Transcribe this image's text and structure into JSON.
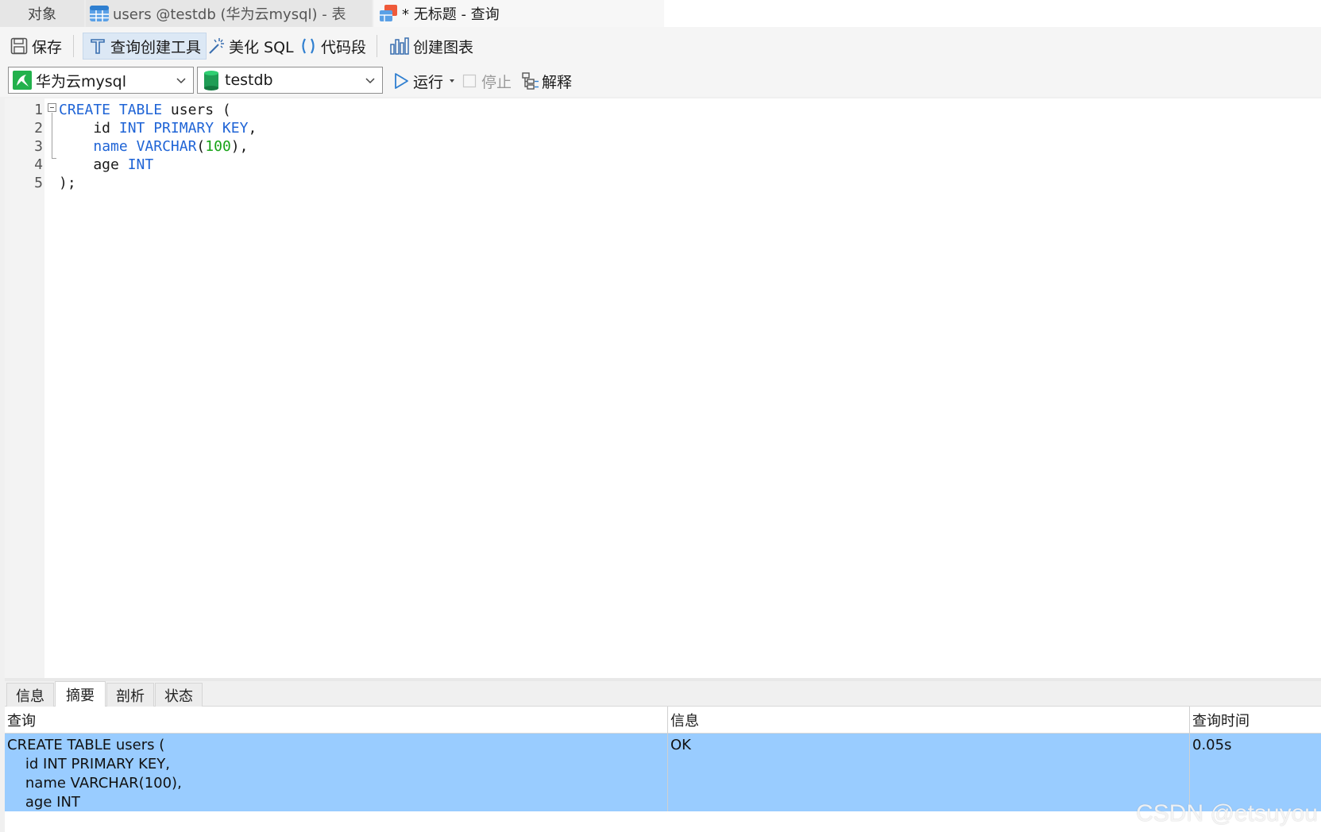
{
  "tabs": {
    "objects": "对象",
    "users_table": "users @testdb (华为云mysql) - 表",
    "query": "* 无标题 - 查询"
  },
  "toolbar": {
    "save": "保存",
    "query_builder": "查询创建工具",
    "beautify_sql": "美化 SQL",
    "code_snippet": "代码段",
    "create_chart": "创建图表"
  },
  "connection_bar": {
    "connection": "华为云mysql",
    "database": "testdb",
    "run": "运行",
    "stop": "停止",
    "explain": "解释"
  },
  "editor": {
    "line_numbers": [
      "1",
      "2",
      "3",
      "4",
      "5"
    ],
    "lines": [
      [
        {
          "t": "CREATE",
          "c": "kw"
        },
        {
          "t": " "
        },
        {
          "t": "TABLE",
          "c": "kw"
        },
        {
          "t": " users ("
        }
      ],
      [
        {
          "t": "    id "
        },
        {
          "t": "INT",
          "c": "kw"
        },
        {
          "t": " "
        },
        {
          "t": "PRIMARY",
          "c": "kw"
        },
        {
          "t": " "
        },
        {
          "t": "KEY",
          "c": "kw"
        },
        {
          "t": ","
        }
      ],
      [
        {
          "t": "    "
        },
        {
          "t": "name",
          "c": "kw"
        },
        {
          "t": " "
        },
        {
          "t": "VARCHAR",
          "c": "kw"
        },
        {
          "t": "("
        },
        {
          "t": "100",
          "c": "num"
        },
        {
          "t": "),"
        }
      ],
      [
        {
          "t": "    age "
        },
        {
          "t": "INT",
          "c": "kw"
        }
      ],
      [
        {
          "t": ");"
        }
      ]
    ]
  },
  "result_tabs": [
    "信息",
    "摘要",
    "剖析",
    "状态"
  ],
  "active_result_tab": "摘要",
  "result_grid": {
    "headers": [
      "查询",
      "信息",
      "查询时间"
    ],
    "rows": [
      {
        "query": "CREATE TABLE users (\n    id INT PRIMARY KEY,\n    name VARCHAR(100),\n    age INT",
        "message": "OK",
        "time": "0.05s"
      }
    ]
  },
  "watermark": "CSDN @etsuyou",
  "colors": {
    "keyword": "#1f64d6",
    "number": "#17a317",
    "selected_row": "#99ccff"
  }
}
